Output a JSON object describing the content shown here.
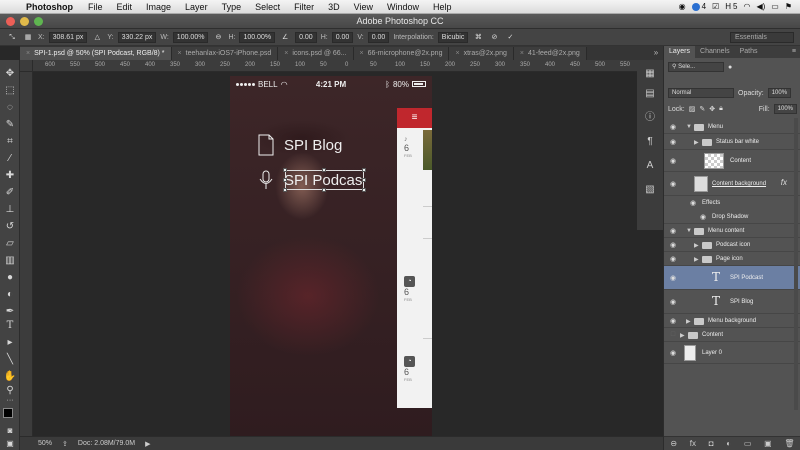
{
  "menubar": {
    "app": "Photoshop",
    "items": [
      "File",
      "Edit",
      "Image",
      "Layer",
      "Type",
      "Select",
      "Filter",
      "3D",
      "View",
      "Window",
      "Help"
    ],
    "status_4": "4",
    "status_5": "5"
  },
  "window": {
    "title": "Adobe Photoshop CC"
  },
  "options": {
    "x_label": "X:",
    "x_value": "308.61 px",
    "y_label": "Y:",
    "y_value": "330.22 px",
    "w_label": "W:",
    "w_value": "100.00%",
    "h_label": "H:",
    "h_value": "100.00%",
    "angle_value": "0.00",
    "hskew_label": "H:",
    "hskew_value": "0.00",
    "vskew_label": "V:",
    "vskew_value": "0.00",
    "interp_label": "Interpolation:",
    "interp_value": "Bicubic",
    "workspace": "Essentials"
  },
  "tabs": [
    {
      "label": "SPI-1.psd @ 50% (SPI Podcast, RGB/8) *",
      "active": true
    },
    {
      "label": "teehanlax-iOS7-iPhone.psd",
      "active": false
    },
    {
      "label": "icons.psd @ 66...",
      "active": false
    },
    {
      "label": "66-microphone@2x.png",
      "active": false
    },
    {
      "label": "xtras@2x.png",
      "active": false
    },
    {
      "label": "41-feed@2x.png",
      "active": false
    }
  ],
  "ruler": [
    "600",
    "550",
    "500",
    "450",
    "400",
    "350",
    "300",
    "250",
    "200",
    "150",
    "100",
    "50",
    "0",
    "50",
    "100",
    "150",
    "200",
    "250",
    "300",
    "350",
    "400",
    "450",
    "500",
    "550",
    "600"
  ],
  "phone": {
    "carrier": "BELL",
    "time": "4:21 PM",
    "battery": "80%",
    "menu_items": [
      "SPI Blog",
      "SPI Podcas"
    ],
    "content_items": [
      {
        "num": "6",
        "mon": "FEB"
      },
      {
        "num": "6",
        "mon": "FEB"
      },
      {
        "num": "6",
        "mon": "FEB"
      }
    ]
  },
  "docstatus": {
    "zoom": "50%",
    "doc": "Doc: 2.08M/79.0M"
  },
  "layers_panel": {
    "tabs": [
      "Layers",
      "Channels",
      "Paths"
    ],
    "kind_filter": "Sele...",
    "blend_mode": "Normal",
    "opacity_label": "Opacity:",
    "opacity_value": "100%",
    "lock_label": "Lock:",
    "fill_label": "Fill:",
    "fill_value": "100%",
    "layers": [
      {
        "name": "Menu"
      },
      {
        "name": "Status bar white"
      },
      {
        "name": "Content"
      },
      {
        "name": "Content background"
      },
      {
        "name": "Effects"
      },
      {
        "name": "Drop Shadow"
      },
      {
        "name": "Menu content"
      },
      {
        "name": "Podcast icon"
      },
      {
        "name": "Page icon"
      },
      {
        "name": "SPI Podcast"
      },
      {
        "name": "SPI Blog"
      },
      {
        "name": "Menu background"
      },
      {
        "name": "Content"
      },
      {
        "name": "Layer 0"
      }
    ]
  },
  "colors": {
    "accent_red": "#c0272d",
    "selection_blue": "#6b7fa3"
  }
}
